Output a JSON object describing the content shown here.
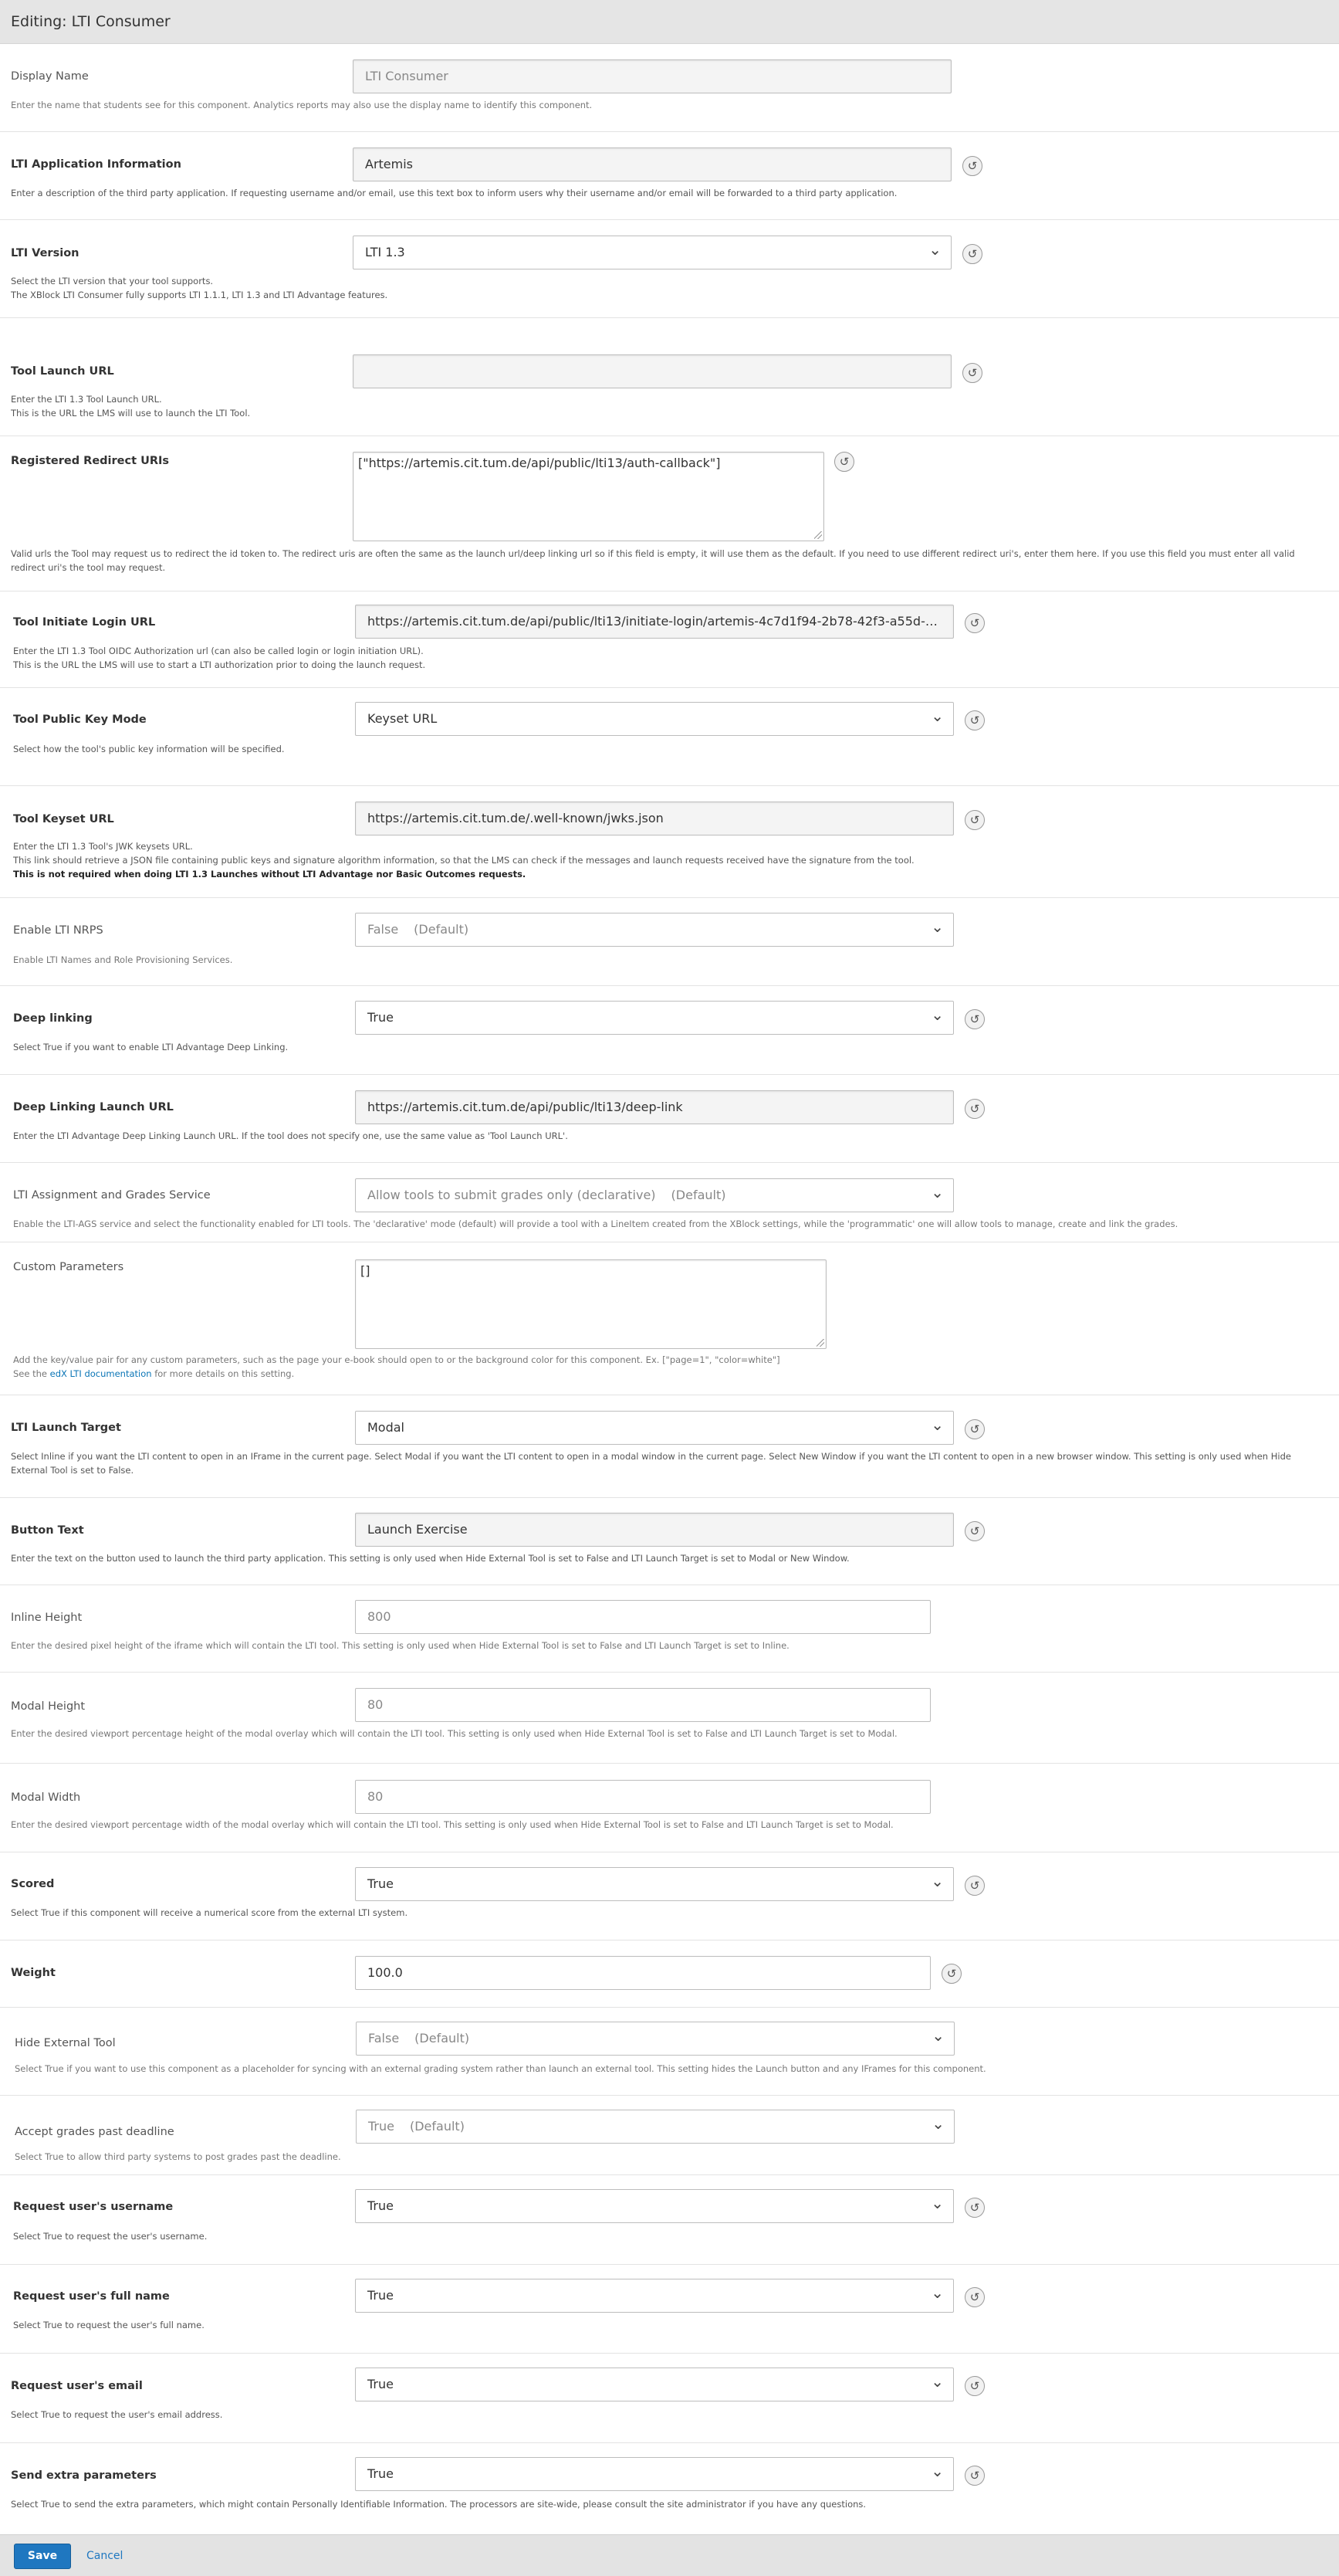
{
  "title": "Editing: LTI Consumer",
  "fields": {
    "display_name": {
      "label": "Display Name",
      "value": "LTI Consumer",
      "help": "Enter the name that students see for this component. Analytics reports may also use the display name to identify this component."
    },
    "lti_app_info": {
      "label": "LTI Application Information",
      "value": "Artemis",
      "help": "Enter a description of the third party application. If requesting username and/or email, use this text box to inform users why their username and/or email will be forwarded to a third party application."
    },
    "lti_version": {
      "label": "LTI Version",
      "value": "LTI 1.3",
      "help1": "Select the LTI version that your tool supports.",
      "help2": "The XBlock LTI Consumer fully supports LTI 1.1.1, LTI 1.3 and LTI Advantage features."
    },
    "tool_launch_url": {
      "label": "Tool Launch URL",
      "value": "",
      "help1": "Enter the LTI 1.3 Tool Launch URL.",
      "help2": "This is the URL the LMS will use to launch the LTI Tool."
    },
    "redirect_uris": {
      "label": "Registered Redirect URIs",
      "value": "[\"https://artemis.cit.tum.de/api/public/lti13/auth-callback\"]",
      "help": "Valid urls the Tool may request us to redirect the id token to. The redirect uris are often the same as the launch url/deep linking url so if this field is empty, it will use them as the default. If you need to use different redirect uri's, enter them here. If you use this field you must enter all valid redirect uri's the tool may request."
    },
    "initiate_login_url": {
      "label": "Tool Initiate Login URL",
      "value": "https://artemis.cit.tum.de/api/public/lti13/initiate-login/artemis-4c7d1f94-2b78-42f3-a55d-fddfd9db...",
      "help1": "Enter the LTI 1.3 Tool OIDC Authorization url (can also be called login or login initiation URL).",
      "help2": "This is the URL the LMS will use to start a LTI authorization prior to doing the launch request."
    },
    "public_key_mode": {
      "label": "Tool Public Key Mode",
      "value": "Keyset URL",
      "help": "Select how the tool's public key information will be specified."
    },
    "keyset_url": {
      "label": "Tool Keyset URL",
      "value": "https://artemis.cit.tum.de/.well-known/jwks.json",
      "help1": "Enter the LTI 1.3 Tool's JWK keysets URL.",
      "help2": "This link should retrieve a JSON file containing public keys and signature algorithm information, so that the LMS can check if the messages and launch requests received have the signature from the tool.",
      "help3": "This is not required when doing LTI 1.3 Launches without LTI Advantage nor Basic Outcomes requests."
    },
    "nrps": {
      "label": "Enable LTI NRPS",
      "value": "False",
      "suffix": "(Default)",
      "help": "Enable LTI Names and Role Provisioning Services."
    },
    "deep_linking": {
      "label": "Deep linking",
      "value": "True",
      "help": "Select True if you want to enable LTI Advantage Deep Linking."
    },
    "deep_linking_url": {
      "label": "Deep Linking Launch URL",
      "value": "https://artemis.cit.tum.de/api/public/lti13/deep-link",
      "help": "Enter the LTI Advantage Deep Linking Launch URL. If the tool does not specify one, use the same value as 'Tool Launch URL'."
    },
    "ags": {
      "label": "LTI Assignment and Grades Service",
      "value": "Allow tools to submit grades only (declarative)",
      "suffix": "(Default)",
      "help": "Enable the LTI-AGS service and select the functionality enabled for LTI tools. The 'declarative' mode (default) will provide a tool with a LineItem created from the XBlock settings, while the 'programmatic' one will allow tools to manage, create and link the grades."
    },
    "custom_params": {
      "label": "Custom Parameters",
      "value": "[]",
      "help1": "Add the key/value pair for any custom parameters, such as the page your e-book should open to or the background color for this component. Ex. [\"page=1\", \"color=white\"]",
      "help2_pre": "See the ",
      "help2_link": "edX LTI documentation",
      "help2_post": " for more details on this setting."
    },
    "launch_target": {
      "label": "LTI Launch Target",
      "value": "Modal",
      "help": "Select Inline if you want the LTI content to open in an IFrame in the current page. Select Modal if you want the LTI content to open in a modal window in the current page. Select New Window if you want the LTI content to open in a new browser window. This setting is only used when Hide External Tool is set to False."
    },
    "button_text": {
      "label": "Button Text",
      "value": "Launch Exercise",
      "help": "Enter the text on the button used to launch the third party application. This setting is only used when Hide External Tool is set to False and LTI Launch Target is set to Modal or New Window."
    },
    "inline_height": {
      "label": "Inline Height",
      "value": "800",
      "help": "Enter the desired pixel height of the iframe which will contain the LTI tool. This setting is only used when Hide External Tool is set to False and LTI Launch Target is set to Inline."
    },
    "modal_height": {
      "label": "Modal Height",
      "value": "80",
      "help": "Enter the desired viewport percentage height of the modal overlay which will contain the LTI tool. This setting is only used when Hide External Tool is set to False and LTI Launch Target is set to Modal."
    },
    "modal_width": {
      "label": "Modal Width",
      "value": "80",
      "help": "Enter the desired viewport percentage width of the modal overlay which will contain the LTI tool. This setting is only used when Hide External Tool is set to False and LTI Launch Target is set to Modal."
    },
    "scored": {
      "label": "Scored",
      "value": "True",
      "help": "Select True if this component will receive a numerical score from the external LTI system."
    },
    "weight": {
      "label": "Weight",
      "value": "100.0"
    },
    "hide_external": {
      "label": "Hide External Tool",
      "value": "False",
      "suffix": "(Default)",
      "help": "Select True if you want to use this component as a placeholder for syncing with an external grading system rather than launch an external tool. This setting hides the Launch button and any IFrames for this component."
    },
    "accept_past_deadline": {
      "label": "Accept grades past deadline",
      "value": "True",
      "suffix": "(Default)",
      "help": "Select True to allow third party systems to post grades past the deadline."
    },
    "request_username": {
      "label": "Request user's username",
      "value": "True",
      "help": "Select True to request the user's username."
    },
    "request_fullname": {
      "label": "Request user's full name",
      "value": "True",
      "help": "Select True to request the user's full name."
    },
    "request_email": {
      "label": "Request user's email",
      "value": "True",
      "help": "Select True to request the user's email address."
    },
    "extra_params": {
      "label": "Send extra parameters",
      "value": "True",
      "help": "Select True to send the extra parameters, which might contain Personally Identifiable Information. The processors are site-wide, please consult the site administrator if you have any questions."
    }
  },
  "footer": {
    "save_label": "Save",
    "cancel_label": "Cancel"
  },
  "icons": {
    "reset": "reset-icon"
  },
  "colors": {
    "primary": "#1f77c0",
    "link": "#0a75b6"
  }
}
